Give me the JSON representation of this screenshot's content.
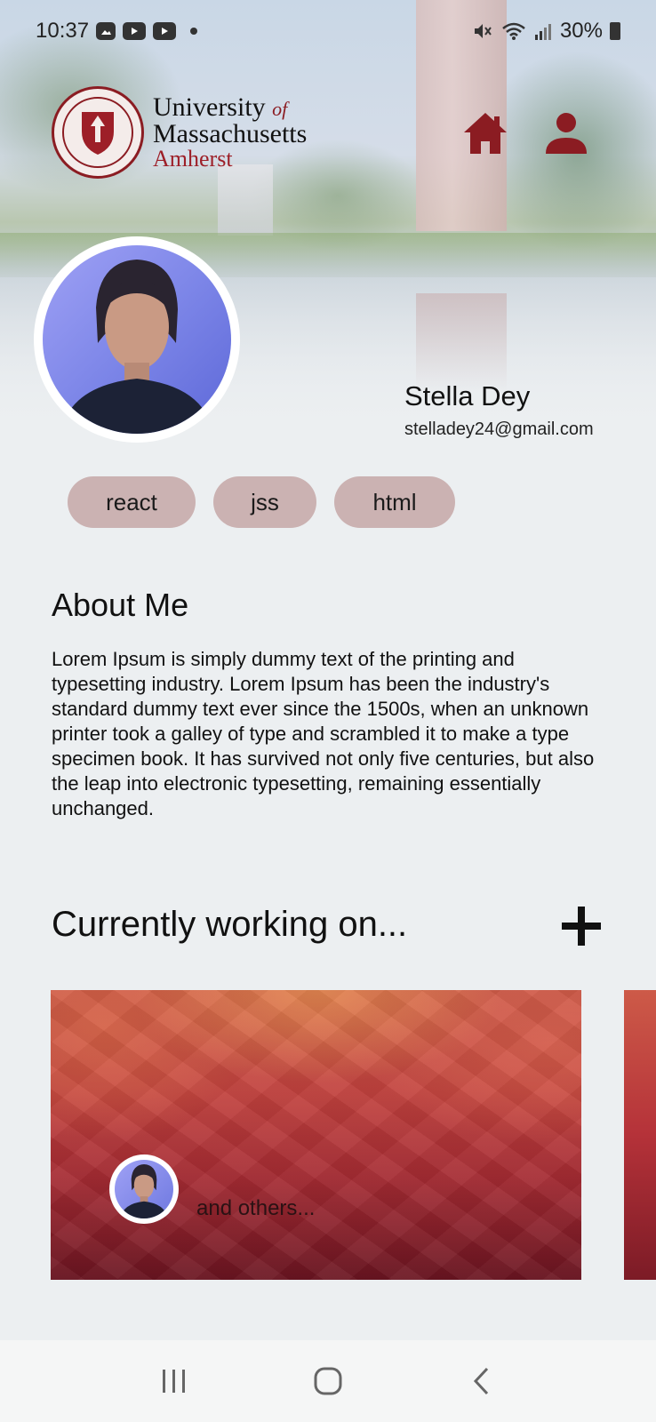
{
  "status_bar": {
    "time": "10:37",
    "battery": "30%",
    "icons": [
      "gallery-icon",
      "youtube-icon",
      "youtube-icon",
      "notification-dot",
      "mute-icon",
      "wifi-icon",
      "signal-icon",
      "battery-icon"
    ]
  },
  "header": {
    "logo_line1": "University",
    "logo_of": "of",
    "logo_line2": "Massachusetts",
    "logo_line3": "Amherst",
    "seal_text": "UNIVERSITY OF MASSACHUSETTS",
    "seal_year": "1863",
    "accent_color": "#8b1c22"
  },
  "profile": {
    "name": "Stella Dey",
    "email": "stelladey24@gmail.com"
  },
  "tags": [
    "react",
    "jss",
    "html"
  ],
  "about": {
    "title": "About Me",
    "text": "Lorem Ipsum is simply dummy text of the printing and typesetting industry. Lorem Ipsum has been the industry's standard dummy text ever since the 1500s, when an unknown printer took a galley of type and scrambled it to make a type specimen book. It has survived not only five centuries, but also the leap into electronic typesetting, remaining essentially unchanged."
  },
  "projects": {
    "title": "Currently working on...",
    "cards": [
      {
        "members_text": "and  others..."
      }
    ]
  },
  "colors": {
    "background": "#eceff1",
    "tag_bg": "#cbb2b2",
    "card_gradient_top": "#cd5a48",
    "card_gradient_bottom": "#6a1521"
  }
}
